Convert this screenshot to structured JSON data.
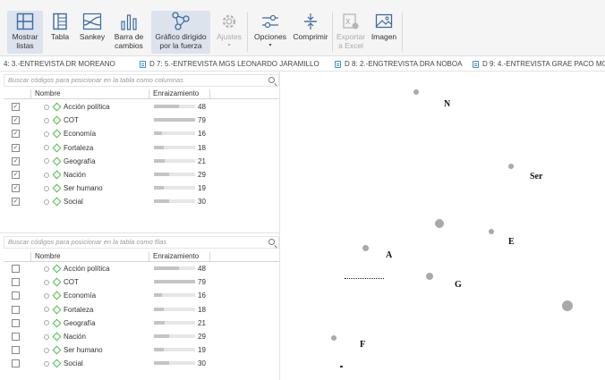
{
  "ribbon": {
    "buttons": [
      {
        "label": "Mostrar\nlistas",
        "icon": "show-lists-icon",
        "state": "active"
      },
      {
        "label": "Tabla",
        "icon": "table-icon",
        "state": "normal"
      },
      {
        "label": "Sankey",
        "icon": "sankey-icon",
        "state": "normal"
      },
      {
        "label": "Barra de\ncambios",
        "icon": "bar-chart-icon",
        "state": "normal"
      },
      {
        "label": "Gráfico dirigido\npor la fuerza",
        "icon": "force-graph-icon",
        "state": "active"
      },
      {
        "label": "Ajustes",
        "icon": "gear-icon",
        "state": "disabled"
      },
      {
        "label": "Opciones",
        "icon": "sliders-icon",
        "state": "normal"
      },
      {
        "label": "Comprimir",
        "icon": "compress-icon",
        "state": "normal"
      },
      {
        "label": "Exportar\na Excel",
        "icon": "excel-icon",
        "state": "disabled"
      },
      {
        "label": "Imagen",
        "icon": "image-icon",
        "state": "normal"
      }
    ]
  },
  "doc_tabs": [
    {
      "label": "4: 3.-ENTREVISTA DR MOREANO",
      "has_icon": false
    },
    {
      "label": "D 7: 5.-ENTREVISTA MGS LEONARDO JARAMILLO",
      "has_icon": true
    },
    {
      "label": "D 8: 2.-ENGTREVISTA DRA NOBOA",
      "has_icon": true
    },
    {
      "label": "D 9: 4.-ENTREVISTA GRAE PACO MO",
      "has_icon": true
    }
  ],
  "columns_panel": {
    "search_placeholder": "Buscar códigos para posicionar en la tabla como columnas",
    "header_name": "Nombre",
    "header_root": "Enraizamiento",
    "rows": [
      {
        "name": "Acción política",
        "value": 48,
        "checked": true
      },
      {
        "name": "COT",
        "value": 79,
        "checked": true
      },
      {
        "name": "Economía",
        "value": 16,
        "checked": true
      },
      {
        "name": "Fortaleza",
        "value": 18,
        "checked": true
      },
      {
        "name": "Geografía",
        "value": 21,
        "checked": true
      },
      {
        "name": "Nación",
        "value": 29,
        "checked": true
      },
      {
        "name": "Ser humano",
        "value": 19,
        "checked": true
      },
      {
        "name": "Social",
        "value": 30,
        "checked": true
      }
    ]
  },
  "rows_panel": {
    "search_placeholder": "Buscar códigos para posicionar en la tabla como filas",
    "header_name": "Nombre",
    "header_root": "Enraizamiento",
    "rows": [
      {
        "name": "Acción política",
        "value": 48,
        "checked": false
      },
      {
        "name": "COT",
        "value": 79,
        "checked": false
      },
      {
        "name": "Economía",
        "value": 16,
        "checked": false
      },
      {
        "name": "Fortaleza",
        "value": 18,
        "checked": false
      },
      {
        "name": "Geografía",
        "value": 21,
        "checked": false
      },
      {
        "name": "Nación",
        "value": 29,
        "checked": false
      },
      {
        "name": "Ser humano",
        "value": 19,
        "checked": false
      },
      {
        "name": "Social",
        "value": 30,
        "checked": false
      }
    ]
  },
  "graph": {
    "labels": [
      "N",
      "Ser",
      "E",
      "A",
      "G",
      "F"
    ]
  },
  "colors": {
    "check_green": "#4bbf4b",
    "active_button": "#dde3ec",
    "node": "#a9a9a9"
  }
}
